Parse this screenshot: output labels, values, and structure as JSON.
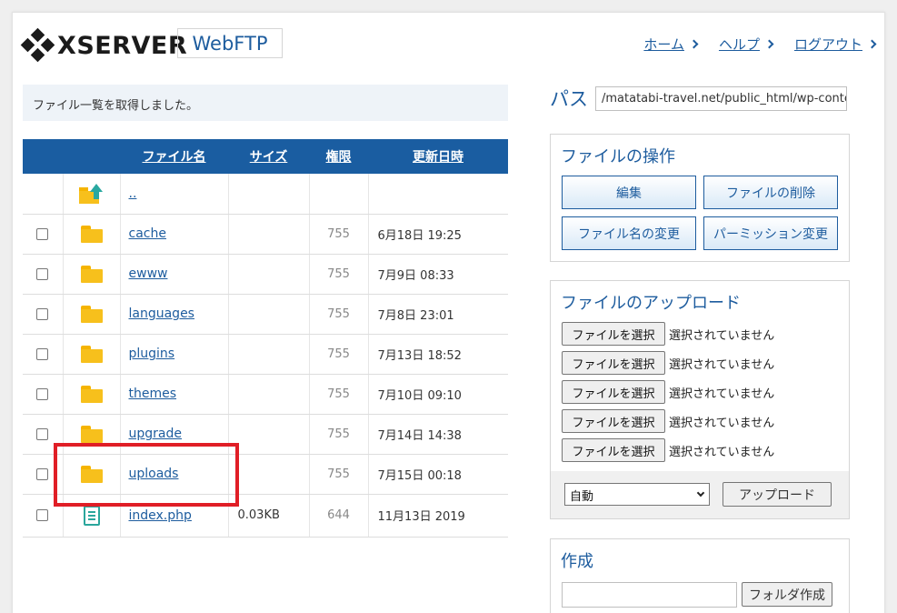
{
  "header": {
    "logo_text": "XSERVER",
    "product": "WebFTP",
    "nav": [
      {
        "label": "ホーム"
      },
      {
        "label": "ヘルプ"
      },
      {
        "label": "ログアウト"
      }
    ]
  },
  "message": "ファイル一覧を取得しました。",
  "table": {
    "headers": {
      "name": "ファイル名",
      "size": "サイズ",
      "perm": "権限",
      "date": "更新日時"
    },
    "parent_link": "..",
    "rows": [
      {
        "name": "cache",
        "size": "",
        "perm": "755",
        "date": "6月18日 19:25",
        "type": "folder"
      },
      {
        "name": "ewww",
        "size": "",
        "perm": "755",
        "date": "7月9日 08:33",
        "type": "folder"
      },
      {
        "name": "languages",
        "size": "",
        "perm": "755",
        "date": "7月8日 23:01",
        "type": "folder"
      },
      {
        "name": "plugins",
        "size": "",
        "perm": "755",
        "date": "7月13日 18:52",
        "type": "folder"
      },
      {
        "name": "themes",
        "size": "",
        "perm": "755",
        "date": "7月10日 09:10",
        "type": "folder"
      },
      {
        "name": "upgrade",
        "size": "",
        "perm": "755",
        "date": "7月14日 14:38",
        "type": "folder"
      },
      {
        "name": "uploads",
        "size": "",
        "perm": "755",
        "date": "7月15日 00:18",
        "type": "folder"
      },
      {
        "name": "index.php",
        "size": "0.03KB",
        "perm": "644",
        "date": "11月13日 2019",
        "type": "file"
      }
    ]
  },
  "path": {
    "label": "パス",
    "value": "/matatabi-travel.net/public_html/wp-content"
  },
  "ops": {
    "title": "ファイルの操作",
    "edit": "編集",
    "delete": "ファイルの削除",
    "rename": "ファイル名の変更",
    "chmod": "パーミッション変更"
  },
  "upload": {
    "title": "ファイルのアップロード",
    "choose_label": "ファイルを選択",
    "none_selected": "選択されていません",
    "mode": "自動",
    "submit": "アップロード"
  },
  "create": {
    "title": "作成",
    "folder_button": "フォルダ作成"
  },
  "colors": {
    "accent": "#1d5c9e",
    "table_header": "#1a5da1",
    "highlight": "#e01e26",
    "folder": "#f7c01c"
  }
}
